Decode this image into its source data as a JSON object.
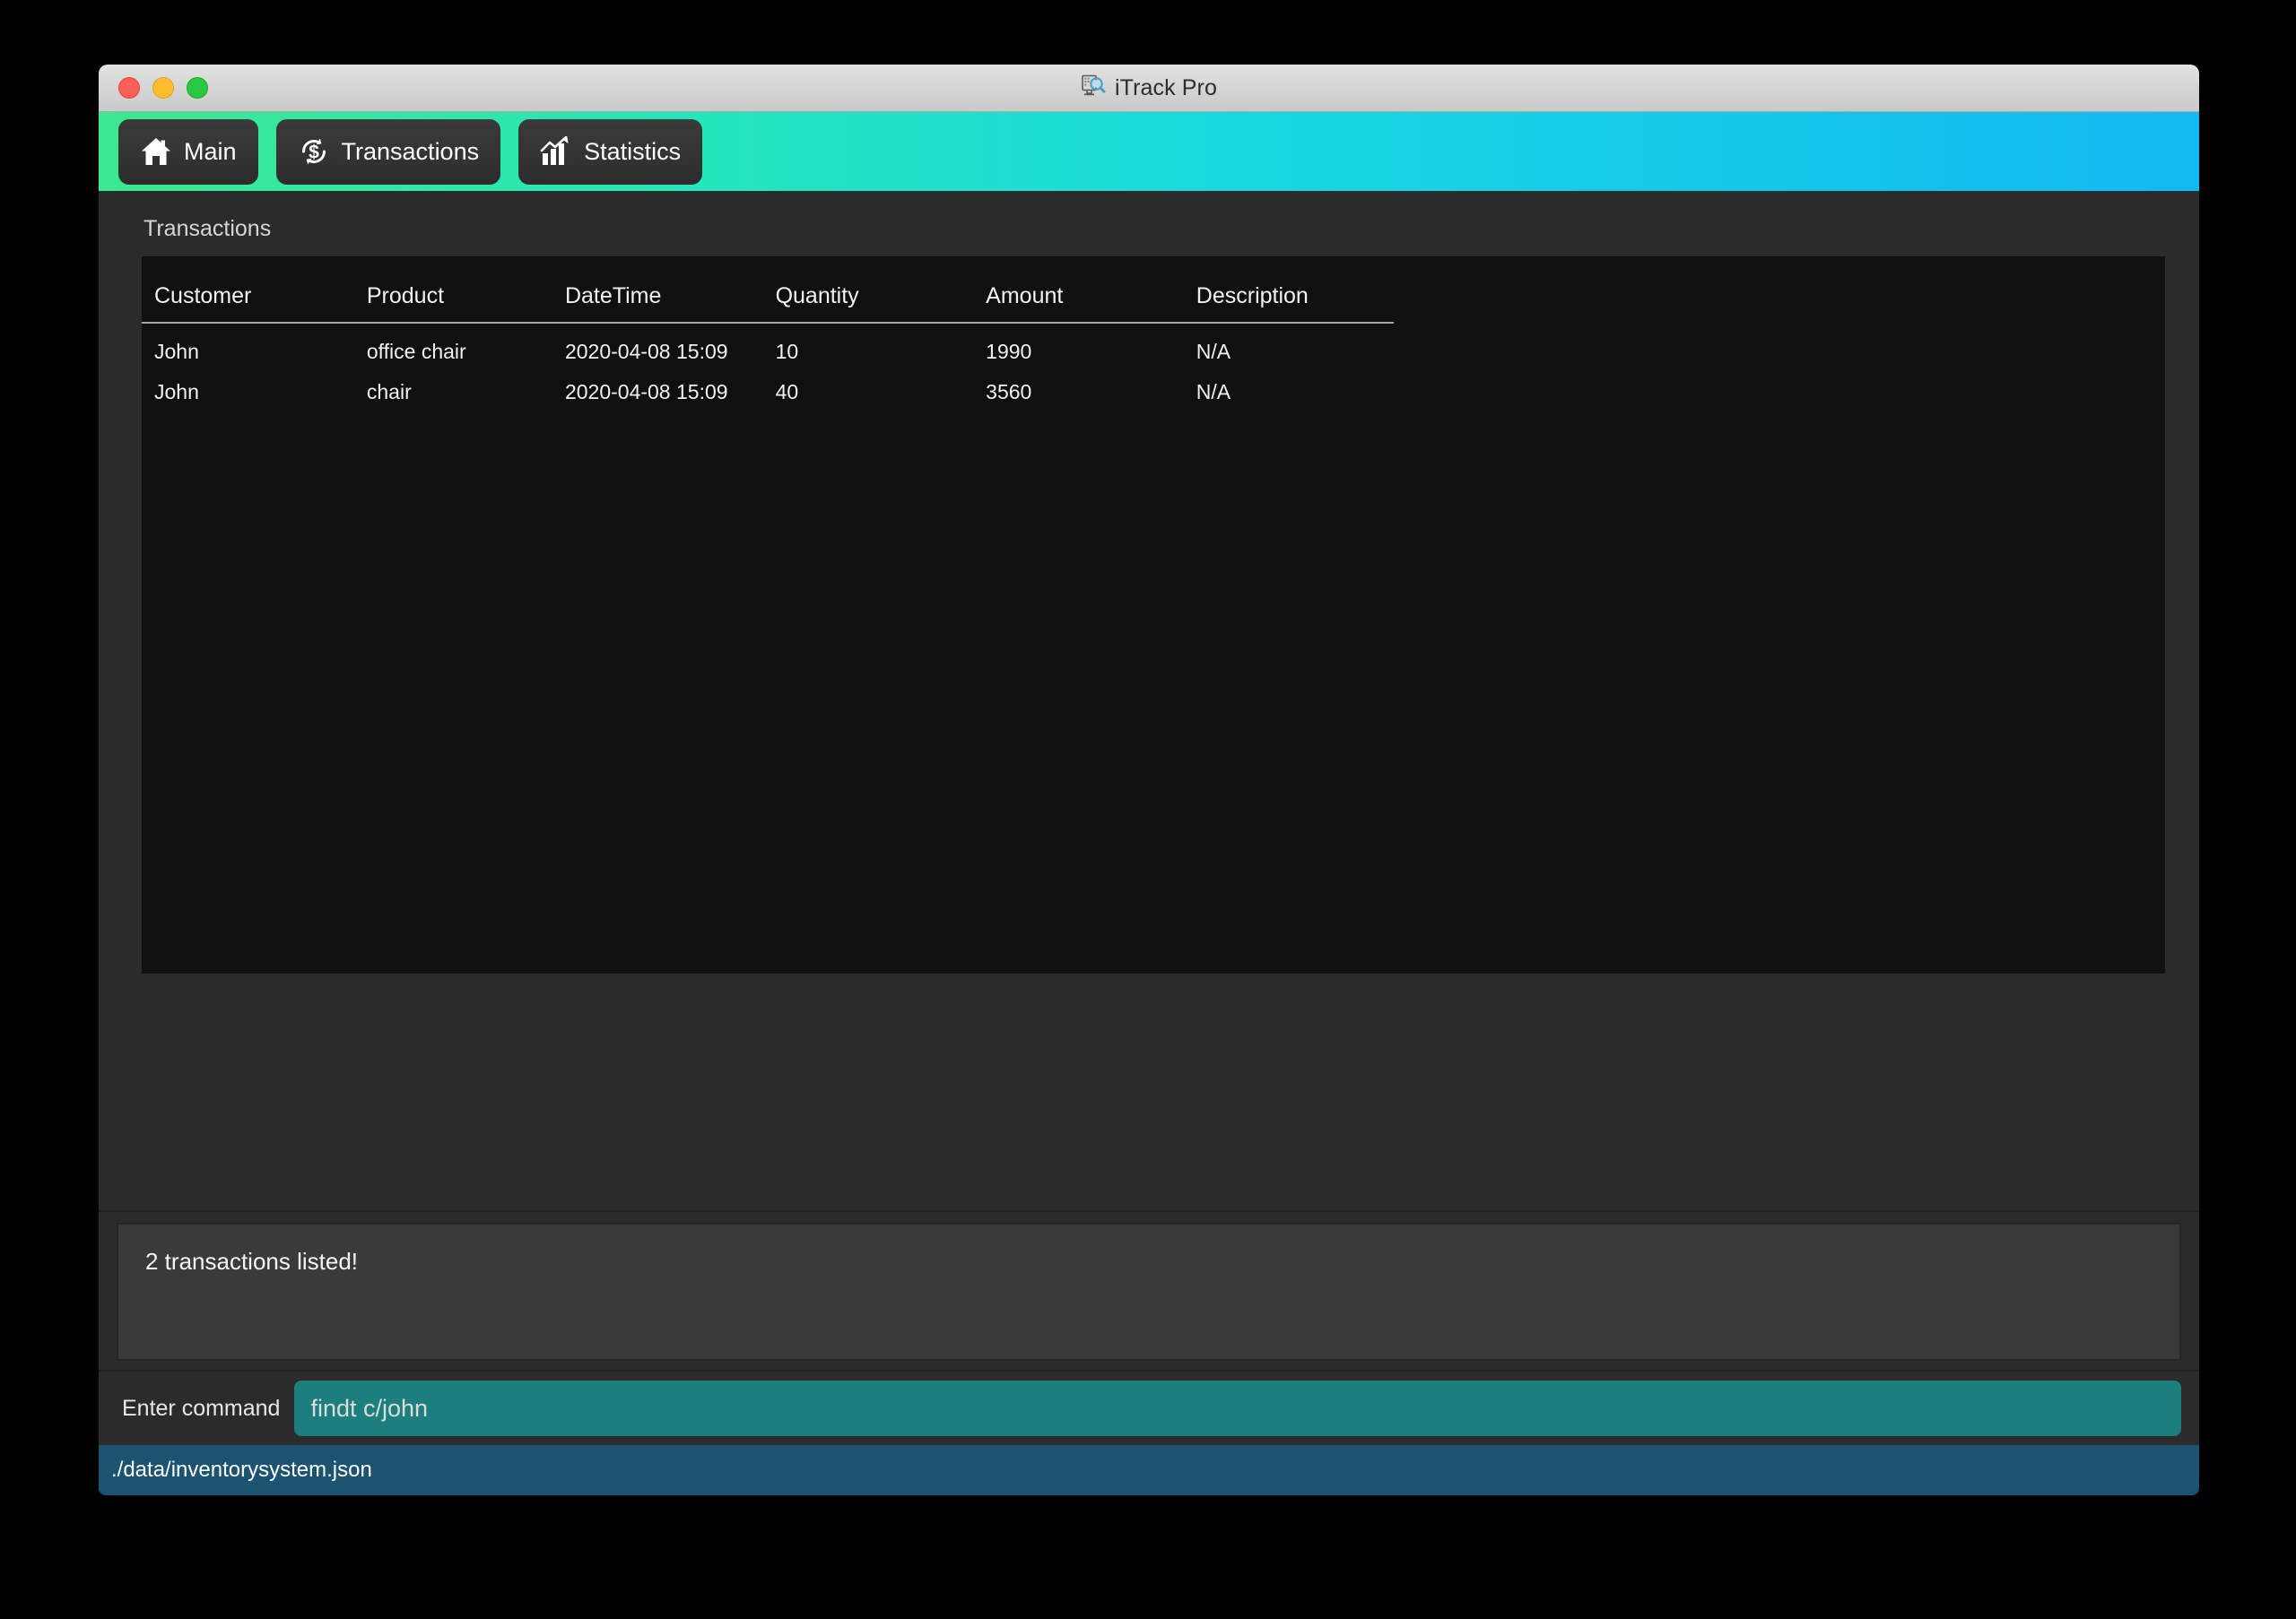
{
  "window": {
    "title": "iTrack Pro",
    "app_icon": "monitor-search-icon",
    "controls": {
      "close": "close-window-button",
      "minimize": "minimize-window-button",
      "maximize": "maximize-window-button"
    }
  },
  "toolbar": {
    "gradient_start": "#3ce890",
    "gradient_end": "#12b9f2",
    "tabs": [
      {
        "label": "Main",
        "icon": "home-icon",
        "active": true
      },
      {
        "label": "Transactions",
        "icon": "dollar-refresh-icon",
        "active": false
      },
      {
        "label": "Statistics",
        "icon": "bar-chart-arrow-icon",
        "active": false
      }
    ]
  },
  "main": {
    "panel_title": "Transactions",
    "table": {
      "columns": [
        "Customer",
        "Product",
        "DateTime",
        "Quantity",
        "Amount",
        "Description"
      ],
      "rows": [
        {
          "customer": "John",
          "product": "office chair",
          "datetime": "2020-04-08 15:09",
          "quantity": "10",
          "amount": "1990",
          "description": "N/A"
        },
        {
          "customer": "John",
          "product": "chair",
          "datetime": "2020-04-08 15:09",
          "quantity": "40",
          "amount": "3560",
          "description": "N/A"
        }
      ]
    }
  },
  "result": {
    "message": "2 transactions listed!"
  },
  "command": {
    "label": "Enter command",
    "value": "findt c/john",
    "placeholder": "findt c/john",
    "field_color": "#1d7e7e"
  },
  "status": {
    "file_path": "./data/inventorysystem.json",
    "bar_color": "#1b5370"
  }
}
